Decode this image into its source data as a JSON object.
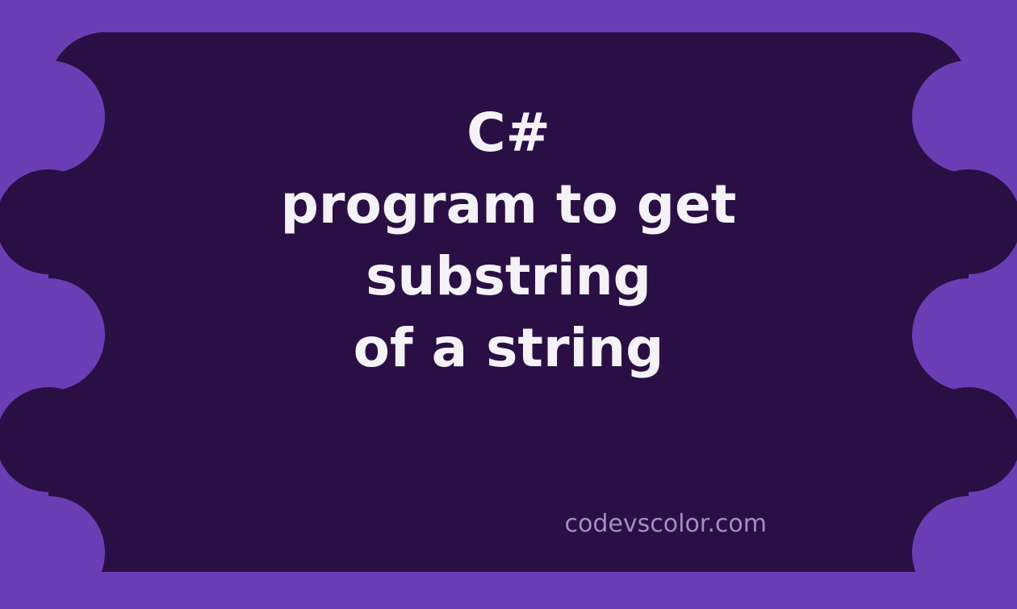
{
  "title_lines": [
    "C#",
    "program to get",
    "substring",
    "of a string"
  ],
  "credit": "codevscolor.com",
  "colors": {
    "bg": "#6a3db5",
    "blob": "#2a0f44",
    "text": "#f5f2f7",
    "credit": "#a58bc9"
  }
}
